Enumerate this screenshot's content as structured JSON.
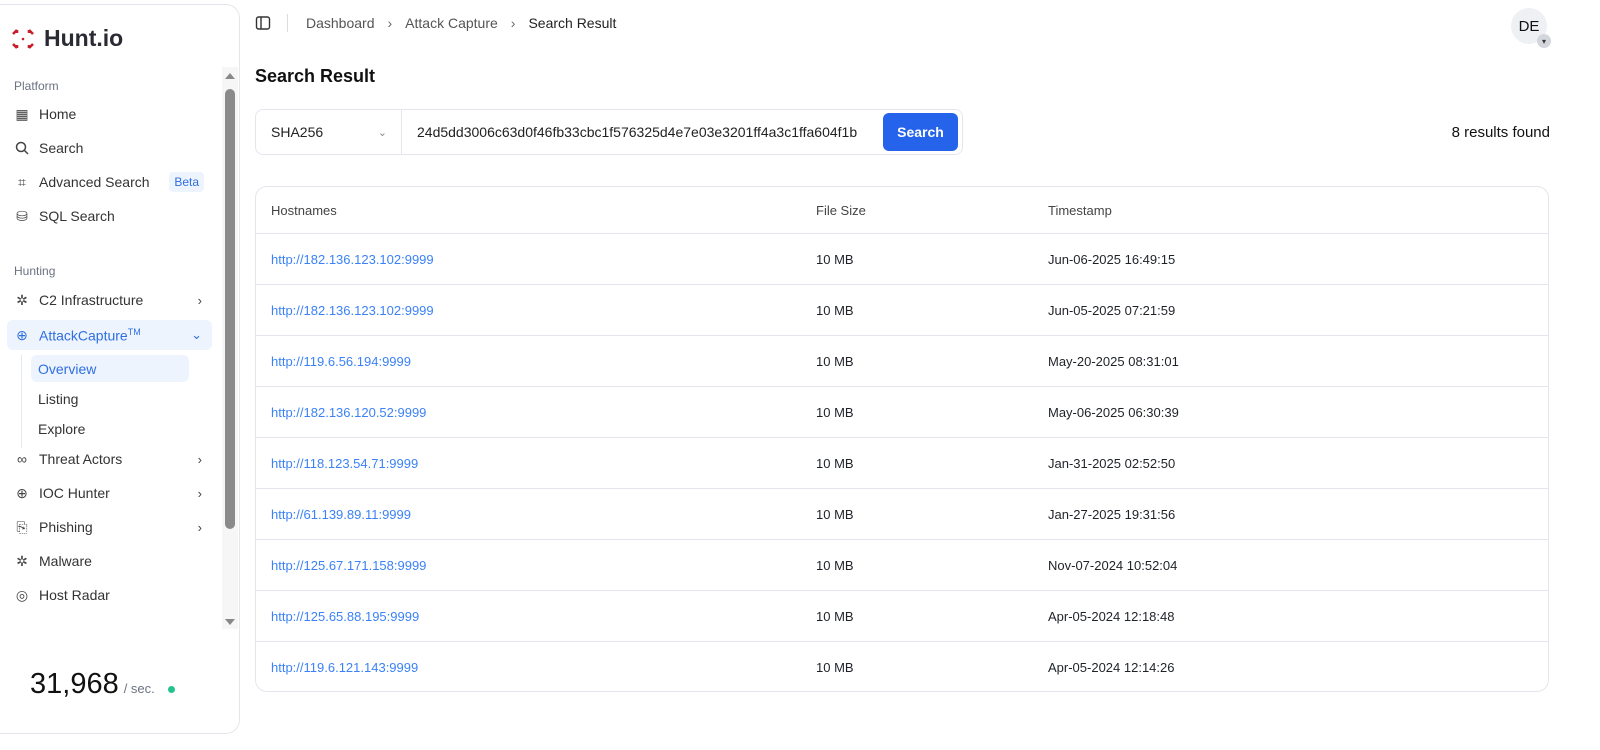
{
  "brand": {
    "name": "Hunt.io",
    "accent": "#c8202a"
  },
  "sidebar": {
    "sections": [
      {
        "label": "Platform",
        "items": [
          {
            "label": "Home",
            "icon": "grid-icon"
          },
          {
            "label": "Search",
            "icon": "search-icon"
          },
          {
            "label": "Advanced Search",
            "icon": "scan-icon",
            "badge": "Beta"
          },
          {
            "label": "SQL Search",
            "icon": "database-icon"
          }
        ]
      },
      {
        "label": "Hunting",
        "items": [
          {
            "label": "C2 Infrastructure",
            "icon": "bug-icon"
          },
          {
            "label": "AttackCapture",
            "tm": "TM",
            "icon": "crosshair-icon",
            "subitems": [
              "Overview",
              "Listing",
              "Explore"
            ]
          },
          {
            "label": "Threat Actors",
            "icon": "mask-icon"
          },
          {
            "label": "IOC Hunter",
            "icon": "plus-circle-icon"
          },
          {
            "label": "Phishing",
            "icon": "file-hook-icon"
          },
          {
            "label": "Malware",
            "icon": "malware-icon"
          },
          {
            "label": "Host Radar",
            "icon": "radar-icon"
          }
        ]
      }
    ],
    "rate": {
      "value": "31,968",
      "unit": "/ sec."
    }
  },
  "breadcrumb": [
    "Dashboard",
    "Attack Capture",
    "Search Result"
  ],
  "user": {
    "initials": "DE"
  },
  "page": {
    "title": "Search Result"
  },
  "search": {
    "type": "SHA256",
    "query": "24d5dd3006c63d0f46fb33cbc1f576325d4e7e03e3201ff4a3c1ffa604f1b",
    "button": "Search",
    "results": "8 results found"
  },
  "table": {
    "headers": [
      "Hostnames",
      "File Size",
      "Timestamp"
    ],
    "rows": [
      [
        "http://182.136.123.102:9999",
        "10 MB",
        "Jun-06-2025 16:49:15"
      ],
      [
        "http://182.136.123.102:9999",
        "10 MB",
        "Jun-05-2025 07:21:59"
      ],
      [
        "http://119.6.56.194:9999",
        "10 MB",
        "May-20-2025 08:31:01"
      ],
      [
        "http://182.136.120.52:9999",
        "10 MB",
        "May-06-2025 06:30:39"
      ],
      [
        "http://118.123.54.71:9999",
        "10 MB",
        "Jan-31-2025 02:52:50"
      ],
      [
        "http://61.139.89.11:9999",
        "10 MB",
        "Jan-27-2025 19:31:56"
      ],
      [
        "http://125.67.171.158:9999",
        "10 MB",
        "Nov-07-2024 10:52:04"
      ],
      [
        "http://125.65.88.195:9999",
        "10 MB",
        "Apr-05-2024 12:18:48"
      ],
      [
        "http://119.6.121.143:9999",
        "10 MB",
        "Apr-05-2024 12:14:26"
      ]
    ]
  }
}
